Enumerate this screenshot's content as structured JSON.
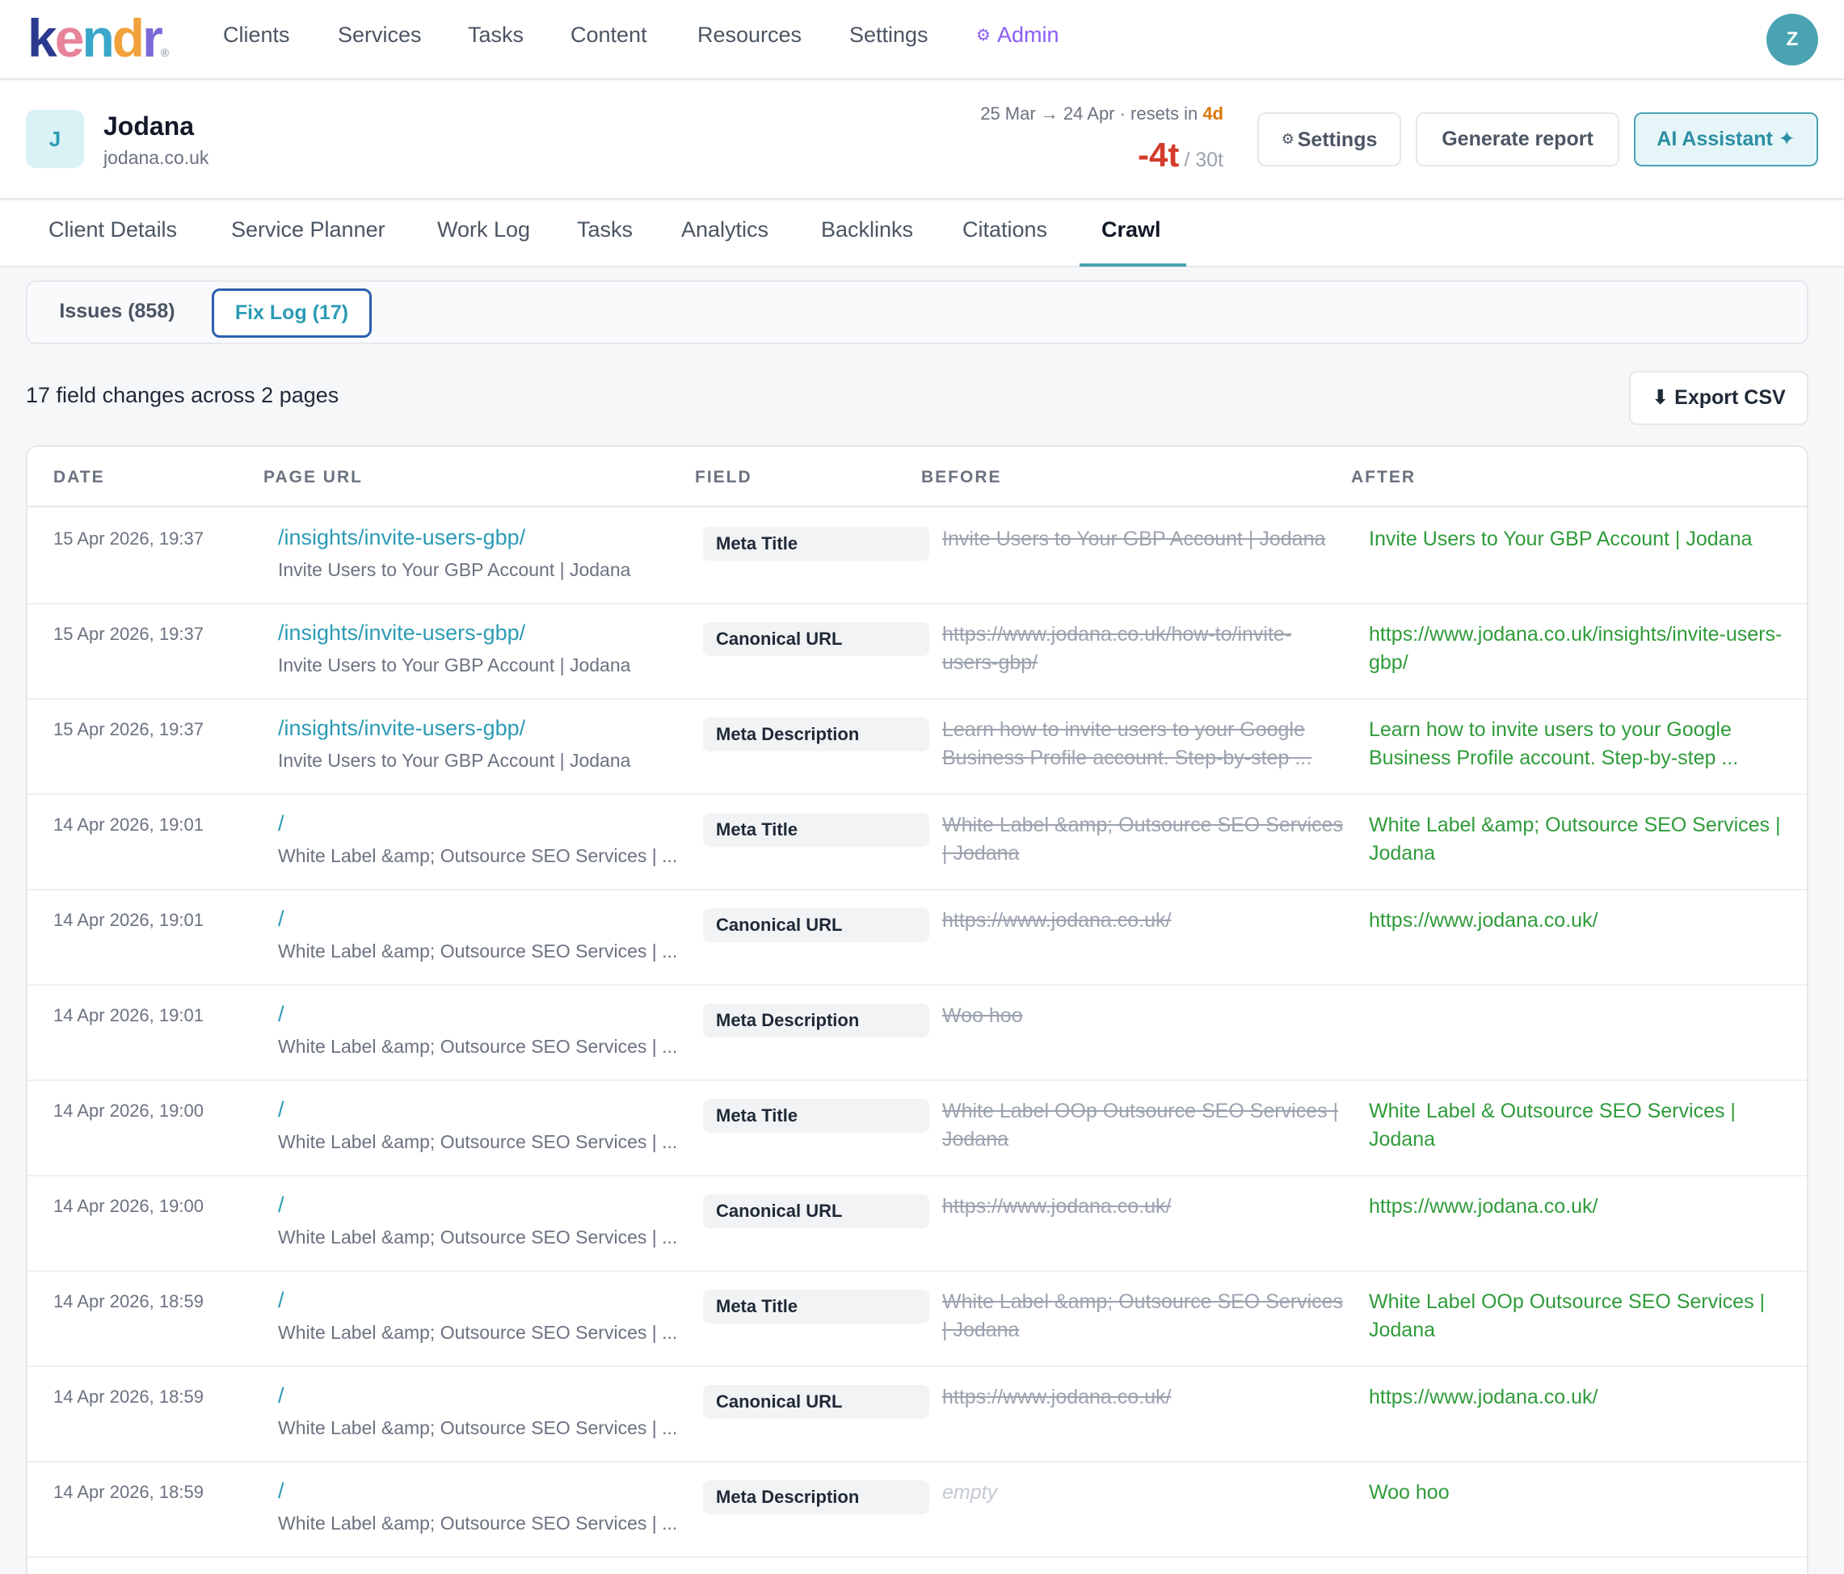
{
  "brand": {
    "logo_letters": [
      "k",
      "e",
      "n",
      "d",
      "r"
    ],
    "logo_colors": [
      "#2b3a8f",
      "#e7839a",
      "#3aa6c9",
      "#f1a23a",
      "#7a6ad8"
    ]
  },
  "nav": {
    "items": [
      "Clients",
      "Services",
      "Tasks",
      "Content",
      "Resources",
      "Settings"
    ],
    "admin_label": "Admin",
    "admin_icon": "gear-icon",
    "avatar_initial": "Z"
  },
  "client": {
    "initial": "J",
    "name": "Jodana",
    "domain": "jodana.co.uk",
    "period_text": "25 Mar → 24 Apr · resets in ",
    "reset_days": "4d",
    "credits_used": "-4t",
    "credits_limit": "/ 30t",
    "buttons": {
      "settings": "Settings",
      "generate_report": "Generate report",
      "ai_assistant": "AI Assistant ✦"
    }
  },
  "tabs": {
    "items": [
      "Client Details",
      "Service Planner",
      "Work Log",
      "Tasks",
      "Analytics",
      "Backlinks",
      "Citations",
      "Crawl"
    ],
    "active": "Crawl"
  },
  "subtabs": {
    "issues": "Issues (858)",
    "fix_log": "Fix Log (17)",
    "active": "fix_log"
  },
  "summary": "17 field changes across 2 pages",
  "export_label": "⬇ Export CSV",
  "table": {
    "headers": {
      "date": "DATE",
      "page_url": "PAGE URL",
      "field": "FIELD",
      "before": "BEFORE",
      "after": "AFTER"
    },
    "rows": [
      {
        "date": "15 Apr 2026, 19:37",
        "url": "/insights/invite-users-gbp/",
        "page_title": "Invite Users to Your GBP Account | Jodana",
        "field": "Meta Title",
        "before": "Invite Users to Your GBP Account | Jodana",
        "after": "Invite Users to Your GBP Account | Jodana"
      },
      {
        "date": "15 Apr 2026, 19:37",
        "url": "/insights/invite-users-gbp/",
        "page_title": "Invite Users to Your GBP Account | Jodana",
        "field": "Canonical URL",
        "before": "https://www.jodana.co.uk/how-to/invite-users-gbp/",
        "after": "https://www.jodana.co.uk/insights/invite-users-gbp/"
      },
      {
        "date": "15 Apr 2026, 19:37",
        "url": "/insights/invite-users-gbp/",
        "page_title": "Invite Users to Your GBP Account | Jodana",
        "field": "Meta Description",
        "before": "Learn how to invite users to your Google Business Profile account. Step-by-step ...",
        "after": "Learn how to invite users to your Google Business Profile account. Step-by-step ..."
      },
      {
        "date": "14 Apr 2026, 19:01",
        "url": "/",
        "page_title": "White Label &amp; Outsource SEO Services | ...",
        "field": "Meta Title",
        "before": "White Label &amp; Outsource SEO Services | Jodana",
        "after": "White Label &amp; Outsource SEO Services | Jodana"
      },
      {
        "date": "14 Apr 2026, 19:01",
        "url": "/",
        "page_title": "White Label &amp; Outsource SEO Services | ...",
        "field": "Canonical URL",
        "before": "https://www.jodana.co.uk/",
        "after": "https://www.jodana.co.uk/"
      },
      {
        "date": "14 Apr 2026, 19:01",
        "url": "/",
        "page_title": "White Label &amp; Outsource SEO Services | ...",
        "field": "Meta Description",
        "before": "Woo hoo",
        "after": ""
      },
      {
        "date": "14 Apr 2026, 19:00",
        "url": "/",
        "page_title": "White Label &amp; Outsource SEO Services | ...",
        "field": "Meta Title",
        "before": "White Label OOp Outsource SEO Services | Jodana",
        "after": "White Label & Outsource SEO Services | Jodana"
      },
      {
        "date": "14 Apr 2026, 19:00",
        "url": "/",
        "page_title": "White Label &amp; Outsource SEO Services | ...",
        "field": "Canonical URL",
        "before": "https://www.jodana.co.uk/",
        "after": "https://www.jodana.co.uk/"
      },
      {
        "date": "14 Apr 2026, 18:59",
        "url": "/",
        "page_title": "White Label &amp; Outsource SEO Services | ...",
        "field": "Meta Title",
        "before": "White Label &amp; Outsource SEO Services | Jodana",
        "after": "White Label OOp Outsource SEO Services | Jodana"
      },
      {
        "date": "14 Apr 2026, 18:59",
        "url": "/",
        "page_title": "White Label &amp; Outsource SEO Services | ...",
        "field": "Canonical URL",
        "before": "https://www.jodana.co.uk/",
        "after": "https://www.jodana.co.uk/"
      },
      {
        "date": "14 Apr 2026, 18:59",
        "url": "/",
        "page_title": "White Label &amp; Outsource SEO Services | ...",
        "field": "Meta Description",
        "before": "",
        "before_placeholder": "empty",
        "after": "Woo hoo"
      }
    ]
  }
}
